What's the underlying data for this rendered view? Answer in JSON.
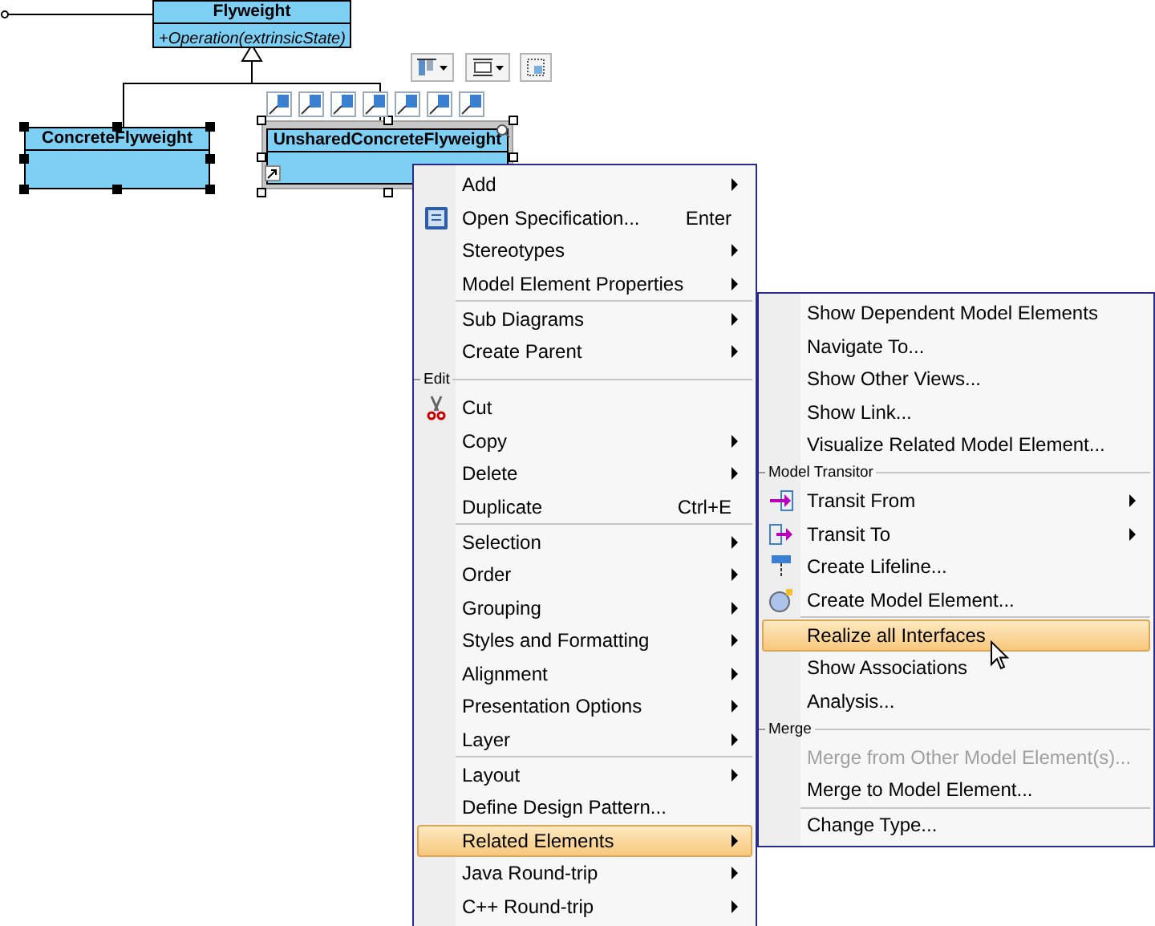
{
  "diagram": {
    "classes": [
      {
        "name": "Flyweight",
        "operations": [
          "+Operation(extrinsicState)"
        ],
        "selected": false,
        "hovered": false
      },
      {
        "name": "ConcreteFlyweight",
        "selected": true,
        "hovered": false
      },
      {
        "name": "UnsharedConcreteFlyweight",
        "selected": true,
        "hovered": true
      }
    ]
  },
  "context_menu": {
    "items": [
      {
        "kind": "item",
        "label": "Add",
        "submenu": true,
        "selected": false
      },
      {
        "kind": "item",
        "label": "Open Specification...",
        "shortcut": "Enter",
        "submenu": false,
        "selected": false
      },
      {
        "kind": "item",
        "label": "Stereotypes",
        "submenu": true,
        "selected": false
      },
      {
        "kind": "item",
        "label": "Model Element Properties",
        "submenu": true,
        "selected": false
      },
      {
        "kind": "separator"
      },
      {
        "kind": "item",
        "label": "Sub Diagrams",
        "submenu": true,
        "selected": false
      },
      {
        "kind": "item",
        "label": "Create Parent",
        "submenu": true,
        "selected": false
      },
      {
        "kind": "header",
        "label": "Edit"
      },
      {
        "kind": "item",
        "label": "Cut",
        "submenu": false,
        "selected": false
      },
      {
        "kind": "item",
        "label": "Copy",
        "submenu": true,
        "selected": false
      },
      {
        "kind": "item",
        "label": "Delete",
        "submenu": true,
        "selected": false
      },
      {
        "kind": "item",
        "label": "Duplicate",
        "shortcut": "Ctrl+E",
        "submenu": false,
        "selected": false
      },
      {
        "kind": "separator"
      },
      {
        "kind": "item",
        "label": "Selection",
        "submenu": true,
        "selected": false
      },
      {
        "kind": "item",
        "label": "Order",
        "submenu": true,
        "selected": false
      },
      {
        "kind": "item",
        "label": "Grouping",
        "submenu": true,
        "selected": false
      },
      {
        "kind": "item",
        "label": "Styles and Formatting",
        "submenu": true,
        "selected": false
      },
      {
        "kind": "item",
        "label": "Alignment",
        "submenu": true,
        "selected": false
      },
      {
        "kind": "item",
        "label": "Presentation Options",
        "submenu": true,
        "selected": false
      },
      {
        "kind": "item",
        "label": "Layer",
        "submenu": true,
        "selected": false
      },
      {
        "kind": "separator"
      },
      {
        "kind": "item",
        "label": "Layout",
        "submenu": true,
        "selected": false
      },
      {
        "kind": "item",
        "label": "Define Design Pattern...",
        "submenu": false,
        "selected": false
      },
      {
        "kind": "item",
        "label": "Related Elements",
        "submenu": true,
        "selected": true
      },
      {
        "kind": "item",
        "label": "Java Round-trip",
        "submenu": true,
        "selected": false
      },
      {
        "kind": "item",
        "label": "C++ Round-trip",
        "submenu": true,
        "selected": false
      }
    ]
  },
  "submenu": {
    "items": [
      {
        "kind": "item",
        "label": "Show Dependent Model Elements",
        "submenu": false,
        "selected": false,
        "disabled": false
      },
      {
        "kind": "item",
        "label": "Navigate To...",
        "submenu": false,
        "selected": false,
        "disabled": false
      },
      {
        "kind": "item",
        "label": "Show Other Views...",
        "submenu": false,
        "selected": false,
        "disabled": false
      },
      {
        "kind": "item",
        "label": "Show Link...",
        "submenu": false,
        "selected": false,
        "disabled": false
      },
      {
        "kind": "item",
        "label": "Visualize Related Model Element...",
        "submenu": false,
        "selected": false,
        "disabled": false
      },
      {
        "kind": "header",
        "label": "Model Transitor"
      },
      {
        "kind": "item",
        "label": "Transit From",
        "submenu": true,
        "selected": false,
        "disabled": false
      },
      {
        "kind": "item",
        "label": "Transit To",
        "submenu": true,
        "selected": false,
        "disabled": false
      },
      {
        "kind": "item",
        "label": "Create Lifeline...",
        "submenu": false,
        "selected": false,
        "disabled": false
      },
      {
        "kind": "item",
        "label": "Create Model Element...",
        "submenu": false,
        "selected": false,
        "disabled": false
      },
      {
        "kind": "separator"
      },
      {
        "kind": "item",
        "label": "Realize all Interfaces",
        "submenu": false,
        "selected": true,
        "disabled": false
      },
      {
        "kind": "item",
        "label": "Show Associations",
        "submenu": false,
        "selected": false,
        "disabled": false
      },
      {
        "kind": "item",
        "label": "Analysis...",
        "submenu": false,
        "selected": false,
        "disabled": false
      },
      {
        "kind": "header",
        "label": "Merge"
      },
      {
        "kind": "item",
        "label": "Merge from Other Model Element(s)...",
        "submenu": false,
        "selected": false,
        "disabled": true
      },
      {
        "kind": "item",
        "label": "Merge to Model Element...",
        "submenu": false,
        "selected": false,
        "disabled": false
      },
      {
        "kind": "separator"
      },
      {
        "kind": "item",
        "label": "Change Type...",
        "submenu": false,
        "selected": false,
        "disabled": false
      }
    ]
  }
}
